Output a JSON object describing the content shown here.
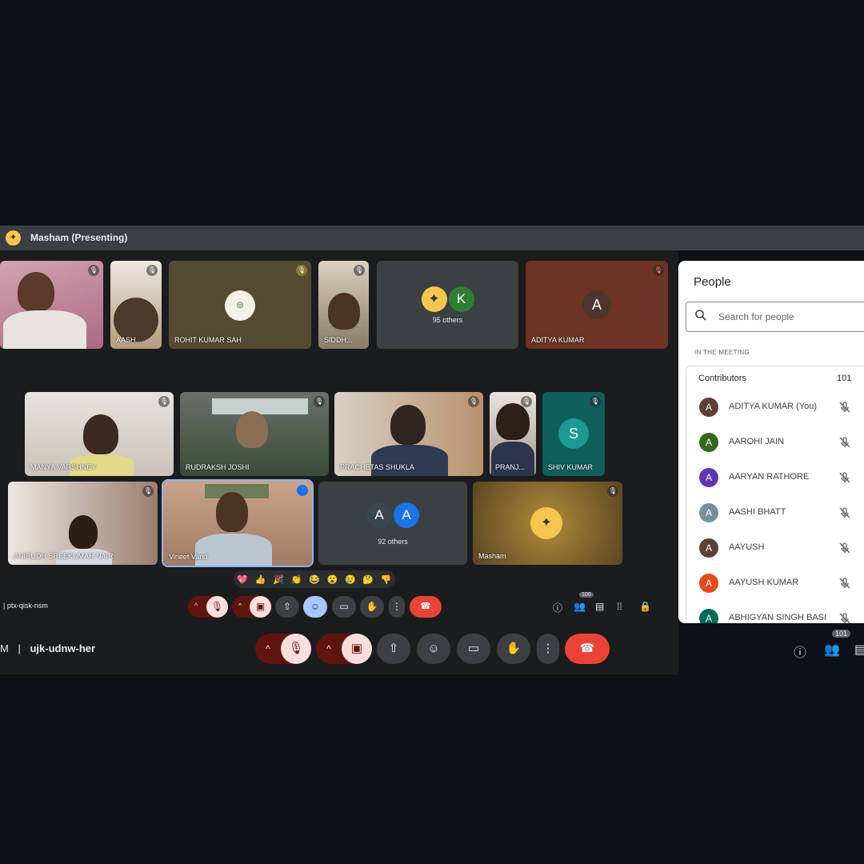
{
  "presenting": {
    "label": "Masham (Presenting)"
  },
  "tiles": {
    "row1": {
      "t2": "AASH...",
      "t3": "ROHIT KUMAR SAH",
      "t4": "SIDDH...",
      "t5": "95 others",
      "t5_avatar": "K",
      "t6": "ADITYA KUMAR",
      "t6_avatar": "A"
    },
    "row2": {
      "t1": "MANYA VARSHNEY",
      "t2": "RUDRAKSH JOSHI",
      "t3": "PRACHETAS SHUKLA",
      "t4": "PRANJ...",
      "t5": "SHIV KUMAR",
      "t5_avatar": "S"
    },
    "row3": {
      "t1": "ANIRUDH SREEKUMAR NAIR",
      "t2": "Vineet Vand",
      "t3": "92 others",
      "t3_a1": "A",
      "t3_a2": "A",
      "t4": "Masham"
    }
  },
  "reactions": [
    "💖",
    "👍",
    "🎉",
    "👏",
    "😂",
    "😮",
    "😢",
    "🤔",
    "👎"
  ],
  "inner_bar": {
    "meeting_code": "ptx-qisk-nsm",
    "people_badge": "100"
  },
  "outer_bar": {
    "meeting_code": "ujk-udnw-her",
    "people_badge": "101",
    "time_fragment": "M"
  },
  "panel": {
    "title": "People",
    "search_placeholder": "Search for people",
    "section": "IN THE MEETING",
    "group_label": "Contributors",
    "group_count": "101",
    "people": [
      {
        "name": "ADITYA KUMAR (You)",
        "initial": "A",
        "color": "#5d4037"
      },
      {
        "name": "AAROHI JAIN",
        "initial": "A",
        "color": "#33691e"
      },
      {
        "name": "AARYAN RATHORE",
        "initial": "A",
        "color": "#5e35b1"
      },
      {
        "name": "AASHI BHATT",
        "initial": "A",
        "color": "#78909c"
      },
      {
        "name": "AAYUSH",
        "initial": "A",
        "color": "#5d4037"
      },
      {
        "name": "AAYUSH KUMAR",
        "initial": "A",
        "color": "#e64a19"
      },
      {
        "name": "ABHIGYAN SINGH BASI",
        "initial": "A",
        "color": "#00695c"
      }
    ]
  },
  "colors": {
    "end_call": "#ea4335",
    "muted_bg": "#f9dedc",
    "mute_dark": "#601410",
    "accent_blue": "#a8c7fa"
  }
}
